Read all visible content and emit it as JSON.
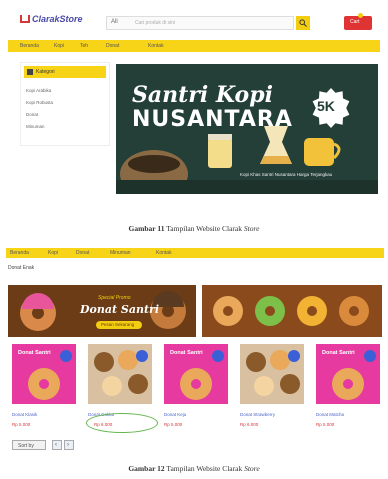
{
  "figure11": {
    "store": {
      "logo_text": "ClarakStore"
    },
    "search": {
      "category": "All",
      "placeholder": "Cari produk di sini"
    },
    "cart_label": "Cart",
    "nav": [
      "Beranda",
      "Kopi",
      "Teh",
      "Donat",
      "Kontak"
    ],
    "sidebar": {
      "heading": "Kategori",
      "items": [
        "Kopi Arabika",
        "Kopi Robusta",
        "Donat",
        "Minuman"
      ]
    },
    "banner": {
      "title_line1": "Santri Kopi",
      "title_line2": "NUSANTARA",
      "badge": "5K",
      "caption": "Kopi Khas Santri Nusantara Harga Terjangkau"
    },
    "caption": {
      "label": "Gambar 11",
      "text": "Tampilan Website Clarak",
      "italic": "Store"
    }
  },
  "figure12": {
    "nav": [
      "Beranda",
      "Kopi",
      "Donat",
      "Minuman",
      "Kontak"
    ],
    "section_title": "Donat Enak",
    "promo": {
      "subtitle": "Special Promo",
      "title": "Donat Santri",
      "button": "Pesan Sekarang"
    },
    "products": [
      {
        "card_title": "Donat Santri",
        "name": "Donat Klasik",
        "price": "Rp 5.000"
      },
      {
        "card_title": "",
        "name": "Donat Coklat",
        "price": "Rp 6.000"
      },
      {
        "card_title": "Donat Santri",
        "name": "Donat Keju",
        "price": "Rp 5.000"
      },
      {
        "card_title": "",
        "name": "Donat Strawberry",
        "price": "Rp 6.000"
      },
      {
        "card_title": "Donat Santri",
        "name": "Donat Matcha",
        "price": "Rp 5.000"
      }
    ],
    "pager": {
      "label": "Sort by",
      "prev": "‹",
      "next": "›"
    },
    "caption": {
      "label": "Gambar 12",
      "text": "Tampilan Website Clarak",
      "italic": "Store"
    }
  },
  "colors": {
    "accent": "#f7d417",
    "cart": "#e03434",
    "banner": "#243f37",
    "promo": "#6b3c16",
    "card_pink": "#e63aa0",
    "highlight": "#64b54e"
  }
}
